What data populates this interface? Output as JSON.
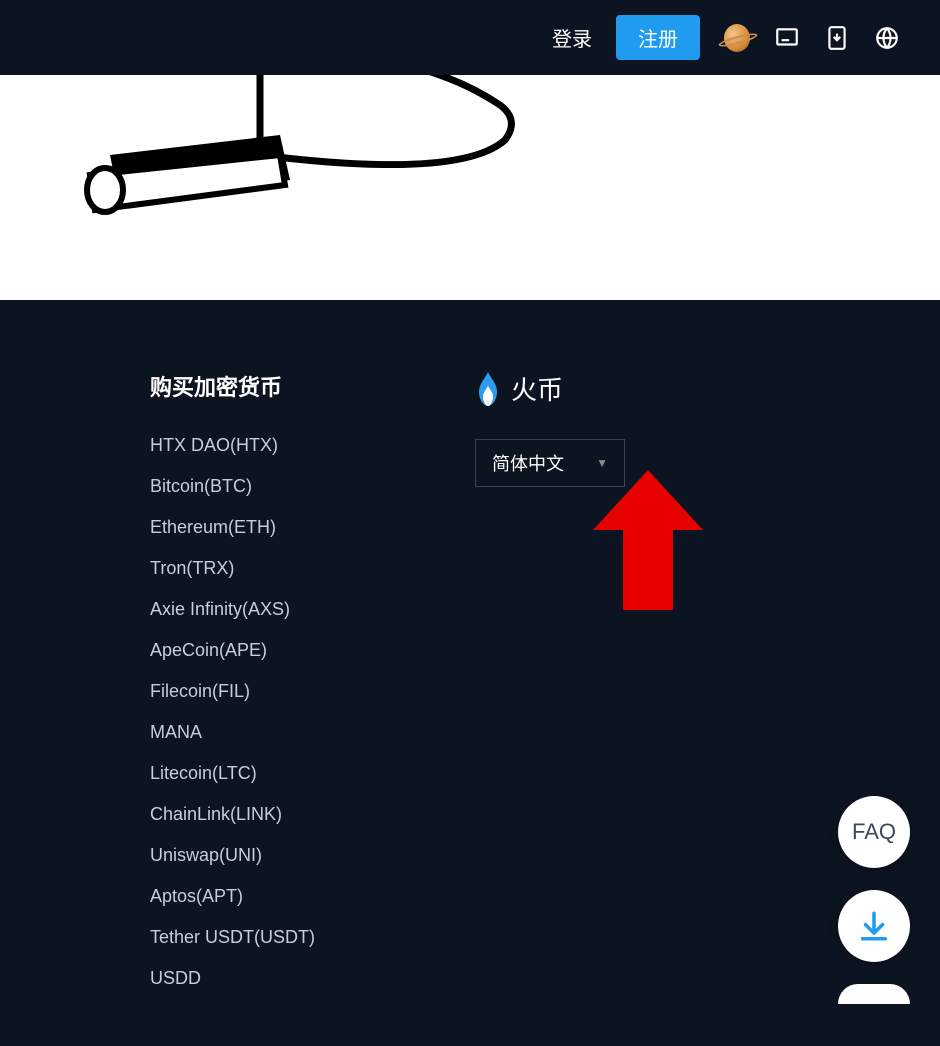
{
  "header": {
    "login_label": "登录",
    "register_label": "注册"
  },
  "footer": {
    "crypto_heading": "购买加密货币",
    "crypto_items": [
      "HTX DAO(HTX)",
      "Bitcoin(BTC)",
      "Ethereum(ETH)",
      "Tron(TRX)",
      "Axie Infinity(AXS)",
      "ApeCoin(APE)",
      "Filecoin(FIL)",
      "MANA",
      "Litecoin(LTC)",
      "ChainLink(LINK)",
      "Uniswap(UNI)",
      "Aptos(APT)",
      "Tether USDT(USDT)",
      "USDD"
    ],
    "brand_name": "火币",
    "lang_selected": "简体中文"
  },
  "fab": {
    "faq_label": "FAQ"
  }
}
